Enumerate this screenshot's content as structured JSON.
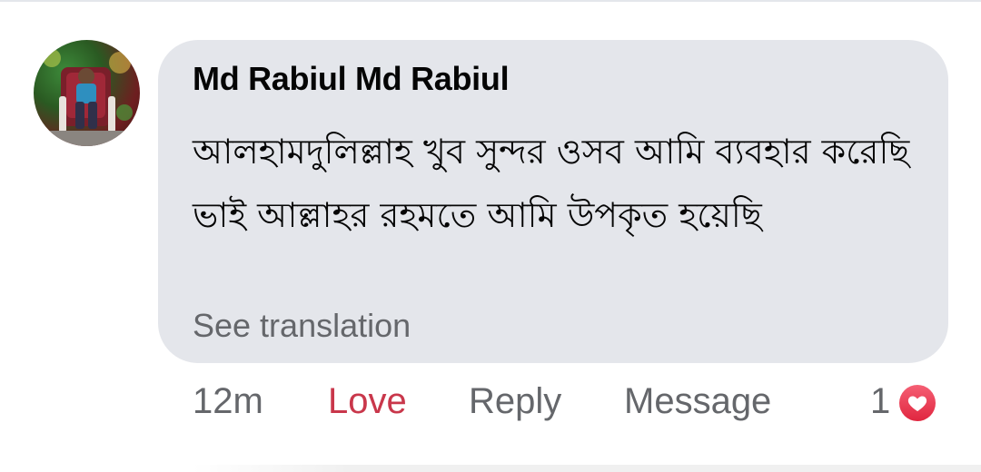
{
  "comment": {
    "author": "Md Rabiul Md Rabiul",
    "text": "আলহামদুলিল্লাহ খুব সুন্দর ওসব আমি ব্যবহার করেছি ভাই আল্লাহর রহমতে আমি উপকৃত হয়েছি",
    "see_translation": "See translation"
  },
  "actions": {
    "time": "12m",
    "love": "Love",
    "reply": "Reply",
    "message": "Message",
    "reaction_count": "1",
    "reaction_icon": "heart-icon"
  },
  "colors": {
    "bubble": "#e4e6eb",
    "love_active": "#c9374b",
    "secondary_text": "#65676b",
    "heart": "#e0263f"
  }
}
